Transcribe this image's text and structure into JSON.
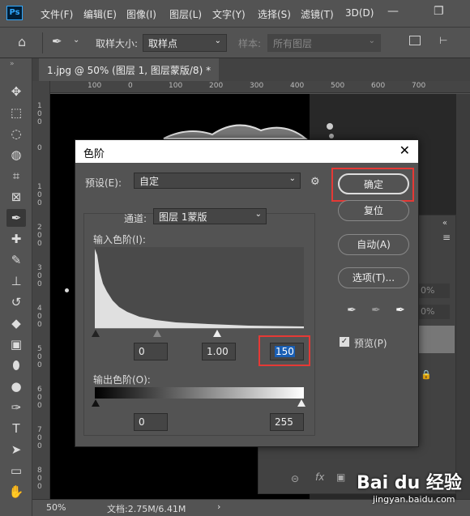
{
  "app": {
    "logo": "Ps"
  },
  "menu": [
    "文件(F)",
    "编辑(E)",
    "图像(I)",
    "图层(L)",
    "文字(Y)",
    "选择(S)",
    "滤镜(T)",
    "3D(D)"
  ],
  "window_controls": {
    "minimize": "—",
    "restore": "❐"
  },
  "options": {
    "sample_size_label": "取样大小:",
    "sample_size_value": "取样点",
    "sample_label": "样本:",
    "sample_value": "所有图层"
  },
  "tab": {
    "title": "1.jpg @ 50% (图层 1, 图层蒙版/8) *",
    "close": "×"
  },
  "ruler_h": [
    "100",
    "0",
    "100",
    "200",
    "300",
    "400",
    "500",
    "600",
    "700"
  ],
  "ruler_v": [
    "1\n0\n0",
    "0",
    "1\n0\n0",
    "2\n0\n0",
    "3\n0\n0",
    "4\n0\n0",
    "5\n0\n0",
    "6\n0\n0",
    "7\n0\n0",
    "8\n0\n0",
    "9\n0\n0"
  ],
  "status": {
    "zoom": "50%",
    "doc": "文档:2.75M/6.41M"
  },
  "dialog": {
    "title": "色阶",
    "preset_label": "预设(E):",
    "preset_value": "自定",
    "channel_label": "通道:",
    "channel_value": "图层 1蒙版",
    "input_label": "输入色阶(I):",
    "input_black": "0",
    "input_gamma": "1.00",
    "input_white": "150",
    "output_label": "输出色阶(O):",
    "output_black": "0",
    "output_white": "255",
    "buttons": {
      "ok": "确定",
      "reset": "复位",
      "auto": "自动(A)",
      "options": "选项(T)..."
    },
    "preview_label": "预览(P)",
    "preview_checked": true
  },
  "watermark": {
    "brand": "Bai du 经验",
    "url": "jingyan.baidu.com"
  },
  "panel_values": [
    "0%",
    "0%"
  ]
}
